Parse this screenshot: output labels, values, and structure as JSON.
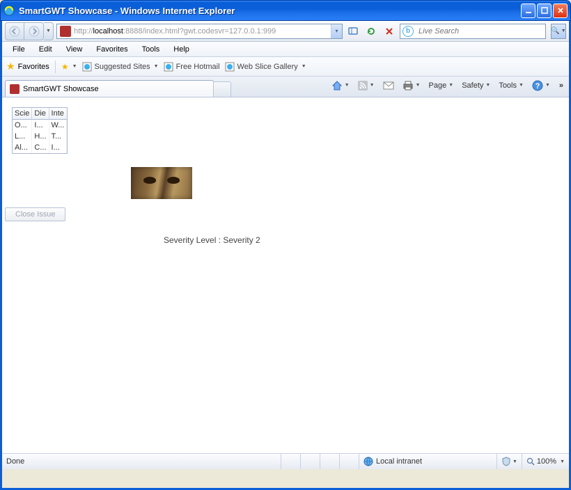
{
  "window": {
    "title": "SmartGWT Showcase - Windows Internet Explorer"
  },
  "address": {
    "url_prefix": "http://",
    "url_host": "localhost",
    "url_rest": ":8888/index.html?gwt.codesvr=127.0.0.1:999"
  },
  "search": {
    "placeholder": "Live Search"
  },
  "menus": {
    "file": "File",
    "edit": "Edit",
    "view": "View",
    "favorites": "Favorites",
    "tools": "Tools",
    "help": "Help"
  },
  "fav_bar": {
    "favorites_label": "Favorites",
    "suggested": "Suggested Sites",
    "hotmail": "Free Hotmail",
    "webslice": "Web Slice Gallery"
  },
  "tab": {
    "label": "SmartGWT Showcase"
  },
  "cmd": {
    "page": "Page",
    "safety": "Safety",
    "tools": "Tools"
  },
  "grid": {
    "headers": [
      "Scie",
      "Die",
      "Inte"
    ],
    "rows": [
      [
        "O...",
        "I...",
        "W..."
      ],
      [
        "L...",
        "H...",
        "T..."
      ],
      [
        "Al...",
        "C...",
        "I..."
      ]
    ]
  },
  "close_issue_label": "Close Issue",
  "severity_text": "Severity Level : Severity 2",
  "status": {
    "done": "Done",
    "zone": "Local intranet",
    "zoom": "100%"
  }
}
